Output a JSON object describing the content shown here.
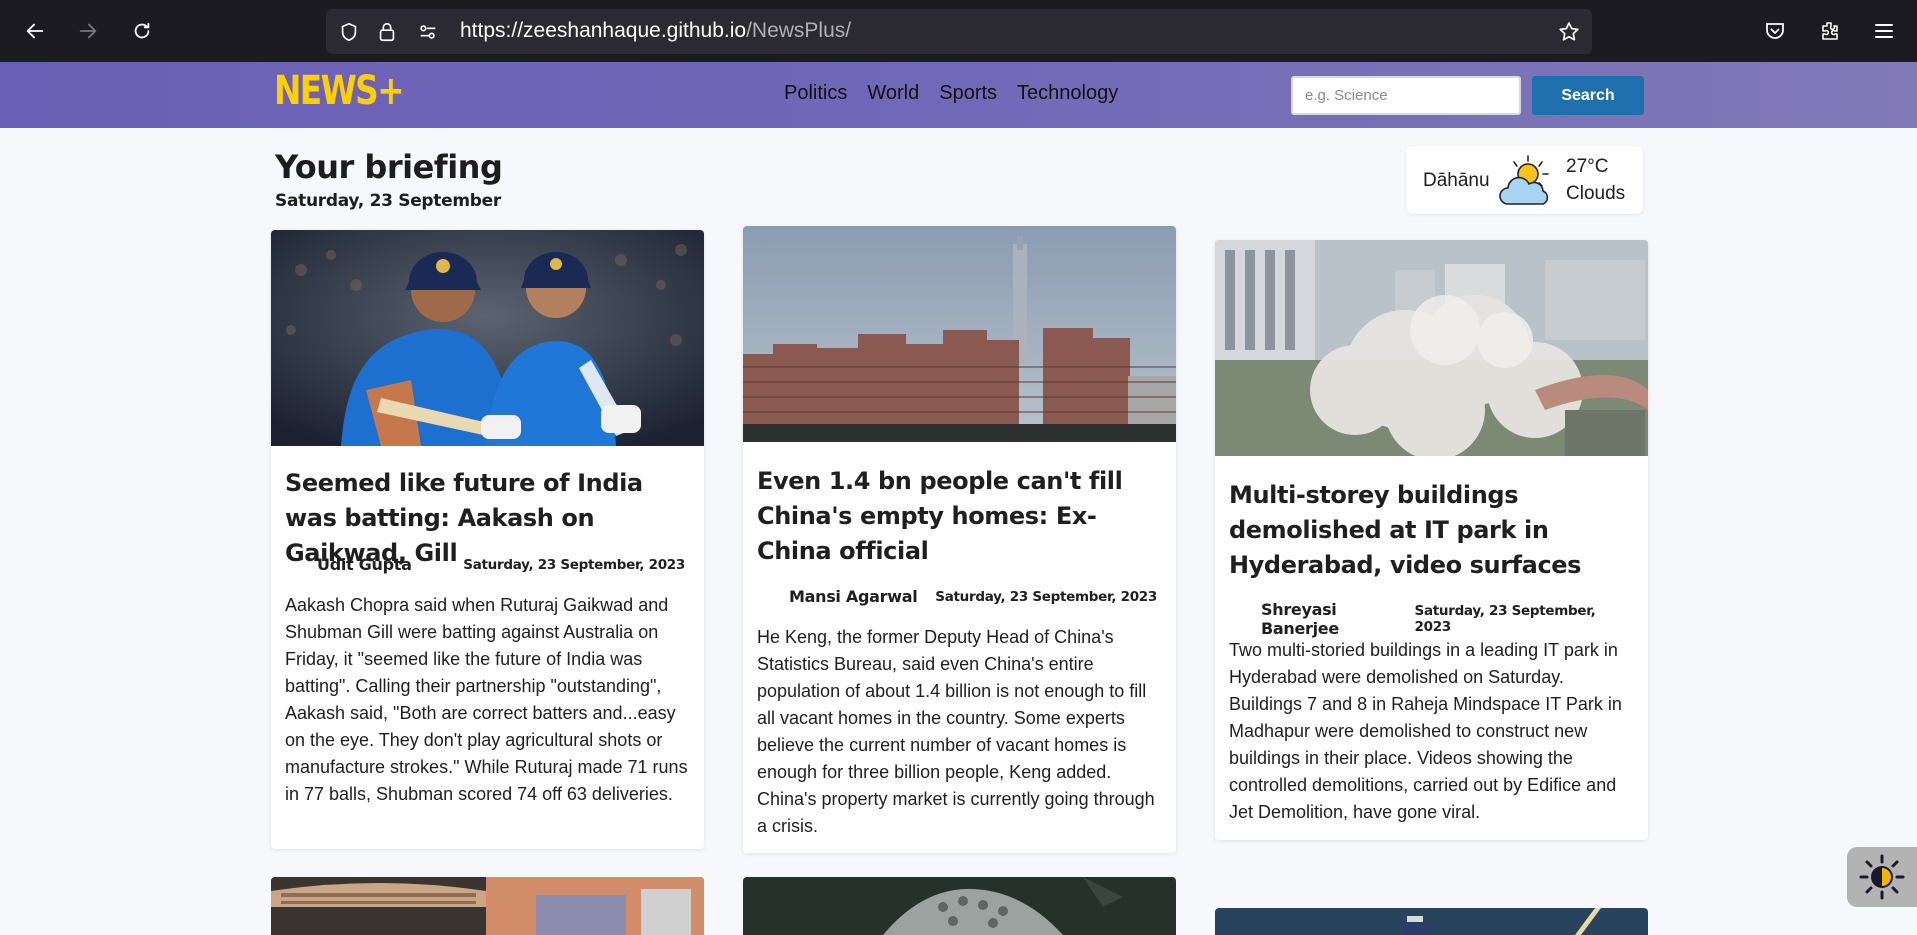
{
  "browser": {
    "url_host": "https://zeeshanhaque.github.io",
    "url_path": "/NewsPlus/"
  },
  "site": {
    "logo": "NEWS+",
    "nav": [
      "Politics",
      "World",
      "Sports",
      "Technology"
    ],
    "search": {
      "placeholder": "e.g. Science",
      "button_label": "Search"
    }
  },
  "briefing": {
    "title": "Your briefing",
    "date": "Saturday, 23 September"
  },
  "weather": {
    "city": "Dāhānu",
    "temperature": "27°C",
    "condition": "Clouds",
    "icon": "partly-cloudy-icon"
  },
  "articles": [
    {
      "title": "Seemed like future of India was batting: Aakash on Gaikwad, Gill",
      "author": "Udit Gupta",
      "date": "Saturday, 23 September, 2023",
      "summary": "Aakash Chopra said when Ruturaj Gaikwad and Shubman Gill were batting against Australia on Friday, it \"seemed like the future of India was batting\". Calling their partnership \"outstanding\", Aakash said, \"Both are correct batters and...easy on the eye. They don't play agricultural shots or manufacture strokes.\" While Ruturaj made 71 runs in 77 balls, Shubman scored 74 off 63 deliveries."
    },
    {
      "title": "Even 1.4 bn people can't fill China's empty homes: Ex-China official",
      "author": "Mansi Agarwal",
      "date": "Saturday, 23 September, 2023",
      "summary": "He Keng, the former Deputy Head of China's Statistics Bureau, said even China's entire population of about 1.4 billion is not enough to fill all vacant homes in the country. Some experts believe the current number of vacant homes is enough for three billion people, Keng added. China's property market is currently going through a crisis."
    },
    {
      "title": "Multi-storey buildings demolished at IT park in Hyderabad, video surfaces",
      "author": "Shreyasi Banerjee",
      "date": "Saturday, 23 September, 2023",
      "summary": "Two multi-storied buildings in a leading IT park in Hyderabad were demolished on Saturday. Buildings 7 and 8 in Raheja Mindspace IT Park in Madhapur were demolished to construct new buildings in their place. Videos showing the controlled demolitions, carried out by Edifice and Jet Demolition, have gone viral."
    }
  ]
}
